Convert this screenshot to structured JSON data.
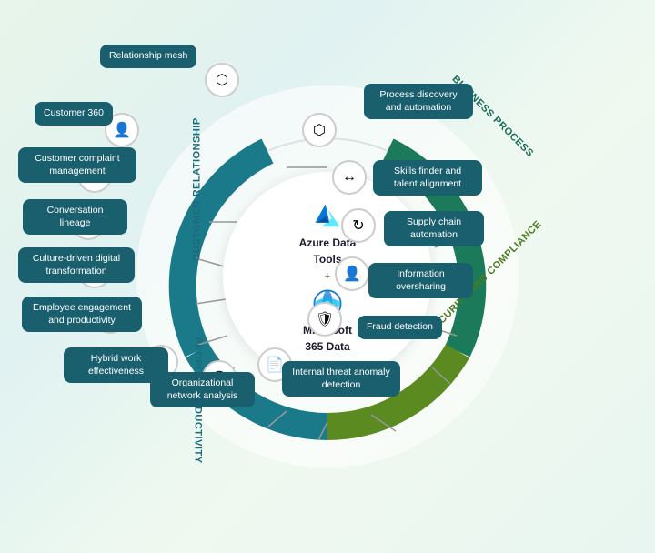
{
  "title": "Azure Data Tools + Microsoft 365 Data",
  "center": {
    "line1": "Azure Data",
    "line2": "Tools",
    "plus": "+",
    "line3": "Microsoft",
    "line4": "365 Data"
  },
  "segments": {
    "customer_relationship": "Customer relationship",
    "business_process": "Business process",
    "security_compliance": "Security and compliance",
    "people_productivity": "People productivity"
  },
  "items": [
    {
      "id": "relationship-mesh",
      "label": "Relationship mesh",
      "side": "top-left"
    },
    {
      "id": "customer-360",
      "label": "Customer 360",
      "side": "left"
    },
    {
      "id": "customer-complaint",
      "label": "Customer complaint\nmanagement",
      "side": "left"
    },
    {
      "id": "conversation-lineage",
      "label": "Conversation\nlineage",
      "side": "left"
    },
    {
      "id": "culture-digital",
      "label": "Culture-driven digital\ntransformation",
      "side": "left"
    },
    {
      "id": "employee-engagement",
      "label": "Employee engagement\nand productivity",
      "side": "bottom-left"
    },
    {
      "id": "hybrid-work",
      "label": "Hybrid work\neffectiveness",
      "side": "bottom"
    },
    {
      "id": "org-network",
      "label": "Organizational\nnetwork analysis",
      "side": "bottom"
    },
    {
      "id": "internal-threat",
      "label": "Internal threat\nanomaly detection",
      "side": "bottom-right"
    },
    {
      "id": "fraud-detection",
      "label": "Fraud detection",
      "side": "right"
    },
    {
      "id": "info-oversharing",
      "label": "Information\noversharing",
      "side": "right"
    },
    {
      "id": "supply-chain",
      "label": "Supply chain\nautomation",
      "side": "top-right"
    },
    {
      "id": "skills-finder",
      "label": "Skills finder and\ntalent alignment",
      "side": "top-right"
    },
    {
      "id": "process-discovery",
      "label": "Process discovery\nand automation",
      "side": "top"
    }
  ],
  "colors": {
    "teal_dark": "#1a5f6e",
    "green_dark": "#2d7a4f",
    "lime_green": "#5a8a1a",
    "accent_teal": "#0097a7",
    "accent_green": "#43a047"
  }
}
